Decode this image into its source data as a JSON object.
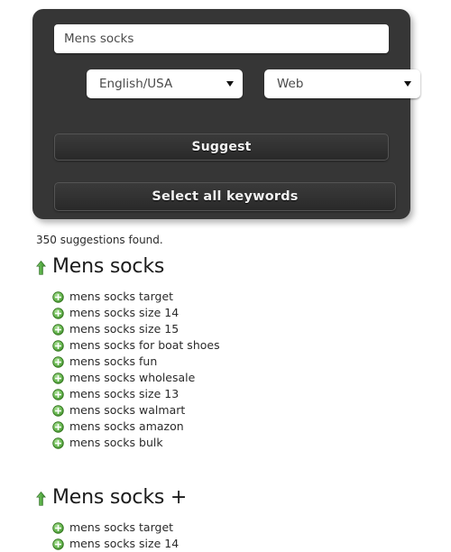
{
  "search_panel": {
    "query_input": {
      "value": "Mens socks",
      "placeholder": "Enter keyword"
    },
    "language_select": {
      "value": "English/USA",
      "caret": "chevron-down-icon"
    },
    "source_select": {
      "value": "Web",
      "caret": "chevron-down-icon"
    },
    "suggest_button": "Suggest",
    "select_all_button": "Select all keywords",
    "panel_color": "#363636"
  },
  "results": {
    "count_text": "350 suggestions found.",
    "accent_green": "#5cb24a",
    "groups": [
      {
        "icon": "arrow-up-icon",
        "title": "Mens socks",
        "keywords": [
          "mens socks target",
          "mens socks size 14",
          "mens socks size 15",
          "mens socks for boat shoes",
          "mens socks fun",
          "mens socks wholesale",
          "mens socks size 13",
          "mens socks walmart",
          "mens socks amazon",
          "mens socks bulk"
        ]
      },
      {
        "icon": "arrow-up-icon",
        "title": "Mens socks +",
        "keywords": [
          "mens socks target",
          "mens socks size 14"
        ]
      }
    ]
  }
}
